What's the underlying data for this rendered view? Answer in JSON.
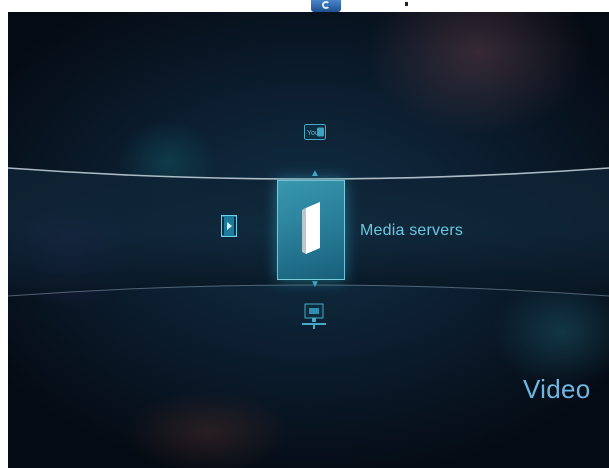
{
  "carousel": {
    "selected_label": "Media servers",
    "items_icons": [
      "youtube-icon",
      "video-file-icon",
      "media-server-icon",
      "network-computer-icon"
    ]
  },
  "category": {
    "label": "Video"
  },
  "colors": {
    "accent": "#5ec4e0",
    "background": "#0a1a2a",
    "tile": "#3aa8c6"
  }
}
